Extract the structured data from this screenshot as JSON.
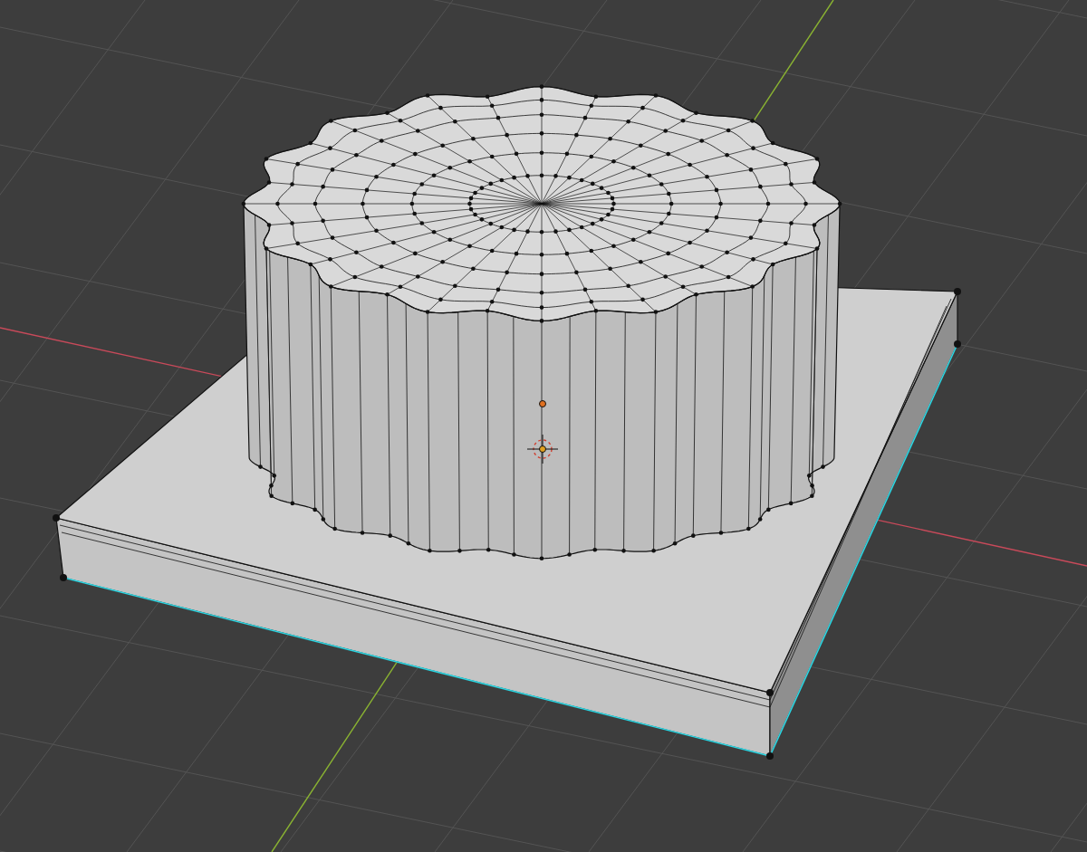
{
  "viewport": {
    "show_grid": true,
    "show_axes": true,
    "show_origin": true,
    "objects": [
      {
        "kind": "slab",
        "selected_edges": true
      },
      {
        "kind": "knob",
        "selected_edges": false
      }
    ]
  }
}
